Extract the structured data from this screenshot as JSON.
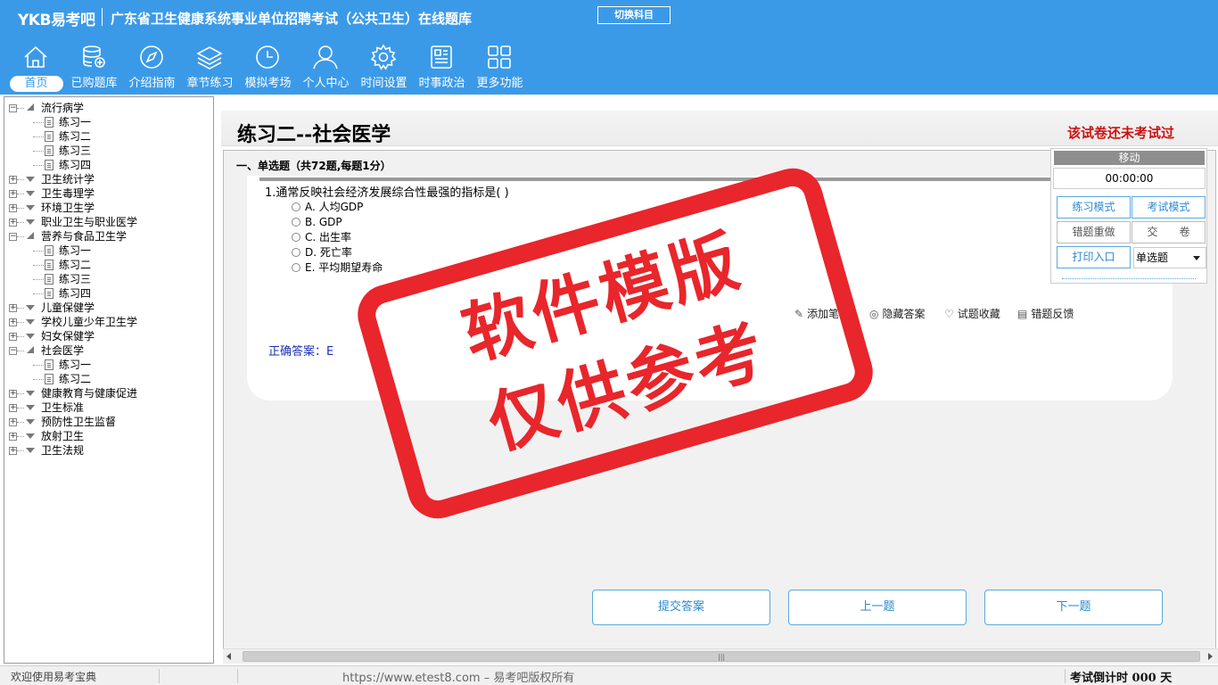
{
  "header": {
    "logo": "YKB易考吧",
    "title": "广东省卫生健康系统事业单位招聘考试（公共卫生）在线题库",
    "switch_subject": "切换科目"
  },
  "nav": [
    {
      "label": "首页",
      "icon": "home-icon",
      "active": true
    },
    {
      "label": "已购题库",
      "icon": "database-icon"
    },
    {
      "label": "介绍指南",
      "icon": "compass-icon"
    },
    {
      "label": "章节练习",
      "icon": "layers-icon"
    },
    {
      "label": "模拟考场",
      "icon": "clock-icon"
    },
    {
      "label": "个人中心",
      "icon": "user-icon"
    },
    {
      "label": "时间设置",
      "icon": "gear-icon"
    },
    {
      "label": "时事政治",
      "icon": "news-icon"
    },
    {
      "label": "更多功能",
      "icon": "grid-icon"
    }
  ],
  "tree": [
    {
      "label": "流行病学",
      "open": true,
      "children": [
        "练习一",
        "练习二",
        "练习三",
        "练习四"
      ]
    },
    {
      "label": "卫生统计学"
    },
    {
      "label": "卫生毒理学"
    },
    {
      "label": "环境卫生学"
    },
    {
      "label": "职业卫生与职业医学"
    },
    {
      "label": "营养与食品卫生学",
      "open": true,
      "children": [
        "练习一",
        "练习二",
        "练习三",
        "练习四"
      ]
    },
    {
      "label": "儿童保健学"
    },
    {
      "label": "学校儿童少年卫生学"
    },
    {
      "label": "妇女保健学"
    },
    {
      "label": "社会医学",
      "open": true,
      "children": [
        "练习一",
        "练习二"
      ]
    },
    {
      "label": "健康教育与健康促进"
    },
    {
      "label": "卫生标准"
    },
    {
      "label": "预防性卫生监督"
    },
    {
      "label": "放射卫生"
    },
    {
      "label": "卫生法规"
    }
  ],
  "exam": {
    "title": "练习二--社会医学",
    "status": "该试卷还未考试过",
    "section": "一、单选题（共72题,每题1分）",
    "question": "1.通常反映社会经济发展综合性最强的指标是( )",
    "options": [
      "A. 人均GDP",
      "B. GDP",
      "C. 出生率",
      "D. 死亡率",
      "E. 平均期望寿命"
    ],
    "tools": {
      "add_note": "添加笔记",
      "hide_answer": "隐藏答案",
      "favorite": "试题收藏",
      "feedback": "错题反馈"
    },
    "answer": "正确答案：E"
  },
  "panel": {
    "move": "移动",
    "timer": "00:00:00",
    "practice_mode": "练习模式",
    "exam_mode": "考试模式",
    "redo_wrong": "错题重做",
    "submit_paper": "交　　卷",
    "print": "打印入口",
    "type_select": "单选题"
  },
  "buttons": {
    "submit": "提交答案",
    "prev": "上一题",
    "next": "下一题"
  },
  "status": {
    "welcome": "欢迎使用易考宝典",
    "url": "https://www.etest8.com – 易考吧版权所有",
    "countdown": "考试倒计时 000 天"
  },
  "watermark": {
    "line1": "软件模版",
    "line2": "仅供参考",
    "color": "#e8262b"
  }
}
